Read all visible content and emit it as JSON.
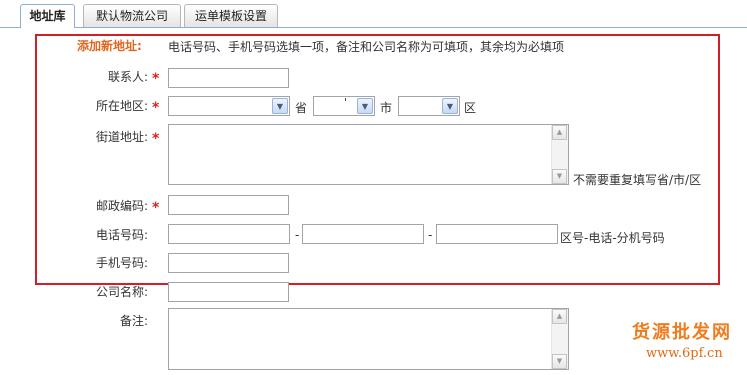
{
  "tabs": [
    {
      "label": "地址库",
      "active": true
    },
    {
      "label": "默认物流公司",
      "active": false
    },
    {
      "label": "运单模板设置",
      "active": false
    }
  ],
  "form": {
    "title": "添加新地址:",
    "hint": "电话号码、手机号码选填一项，备注和公司名称为可填项，其余均为必填项",
    "required_mark": "*",
    "contact_label": "联系人:",
    "region_label": "所在地区:",
    "province_value": "",
    "province_unit": "省",
    "city_value": "'",
    "city_unit": "市",
    "district_value": "",
    "district_unit": "区",
    "street_label": "街道地址:",
    "street_hint": "不需要重复填写省/市/区",
    "zip_label": "邮政编码:",
    "phone_label": "电话号码:",
    "phone_sep1": "-",
    "phone_sep2": "-",
    "phone_hint": "区号-电话-分机号码",
    "mobile_label": "手机号码:",
    "company_label": "公司名称:",
    "remark_label": "备注:"
  },
  "watermark": {
    "line1": "货源批发网",
    "line2": "www.6pf.cn"
  },
  "colors": {
    "accent": "#e0661f",
    "required": "#d8231b",
    "highlight_box": "#d21f26",
    "tab_border": "#8cb0d3"
  }
}
